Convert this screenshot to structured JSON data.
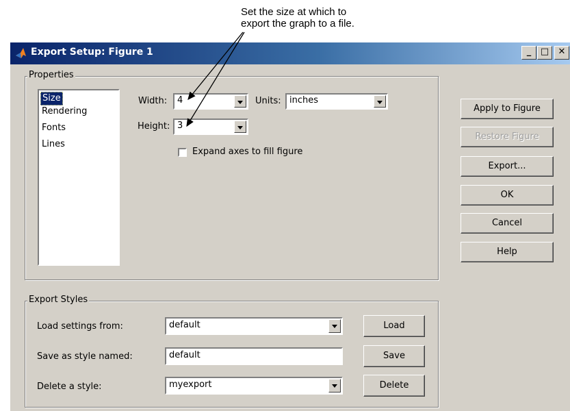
{
  "callout": {
    "line1": "Set the size at which to",
    "line2": "export the graph to a file."
  },
  "window": {
    "title": "Export Setup: Figure 1",
    "minimize": "_",
    "maximize": "□",
    "close": "✕"
  },
  "properties": {
    "label": "Properties",
    "items": [
      "Size",
      "Rendering",
      "Fonts",
      "Lines"
    ],
    "selected": "Size",
    "width_label": "Width:",
    "width_value": "4",
    "height_label": "Height:",
    "height_value": "3",
    "units_label": "Units:",
    "units_value": "inches",
    "expand_label": "Expand axes to fill figure",
    "expand_checked": false
  },
  "buttons": {
    "apply": "Apply to Figure",
    "restore": "Restore Figure",
    "export": "Export...",
    "ok": "OK",
    "cancel": "Cancel",
    "help": "Help"
  },
  "export_styles": {
    "label": "Export Styles",
    "load_label": "Load settings from:",
    "load_value": "default",
    "load_button": "Load",
    "save_label": "Save as style named:",
    "save_value": "default",
    "save_button": "Save",
    "delete_label": "Delete a style:",
    "delete_value": "myexport",
    "delete_button": "Delete"
  },
  "colors": {
    "title_start": "#0a246a",
    "title_end": "#a6caf0",
    "dialog_bg": "#d4d0c8",
    "selection": "#0a246a"
  },
  "icons": {
    "app": "matlab-logo-icon",
    "dropdown": "chevron-down-icon"
  }
}
